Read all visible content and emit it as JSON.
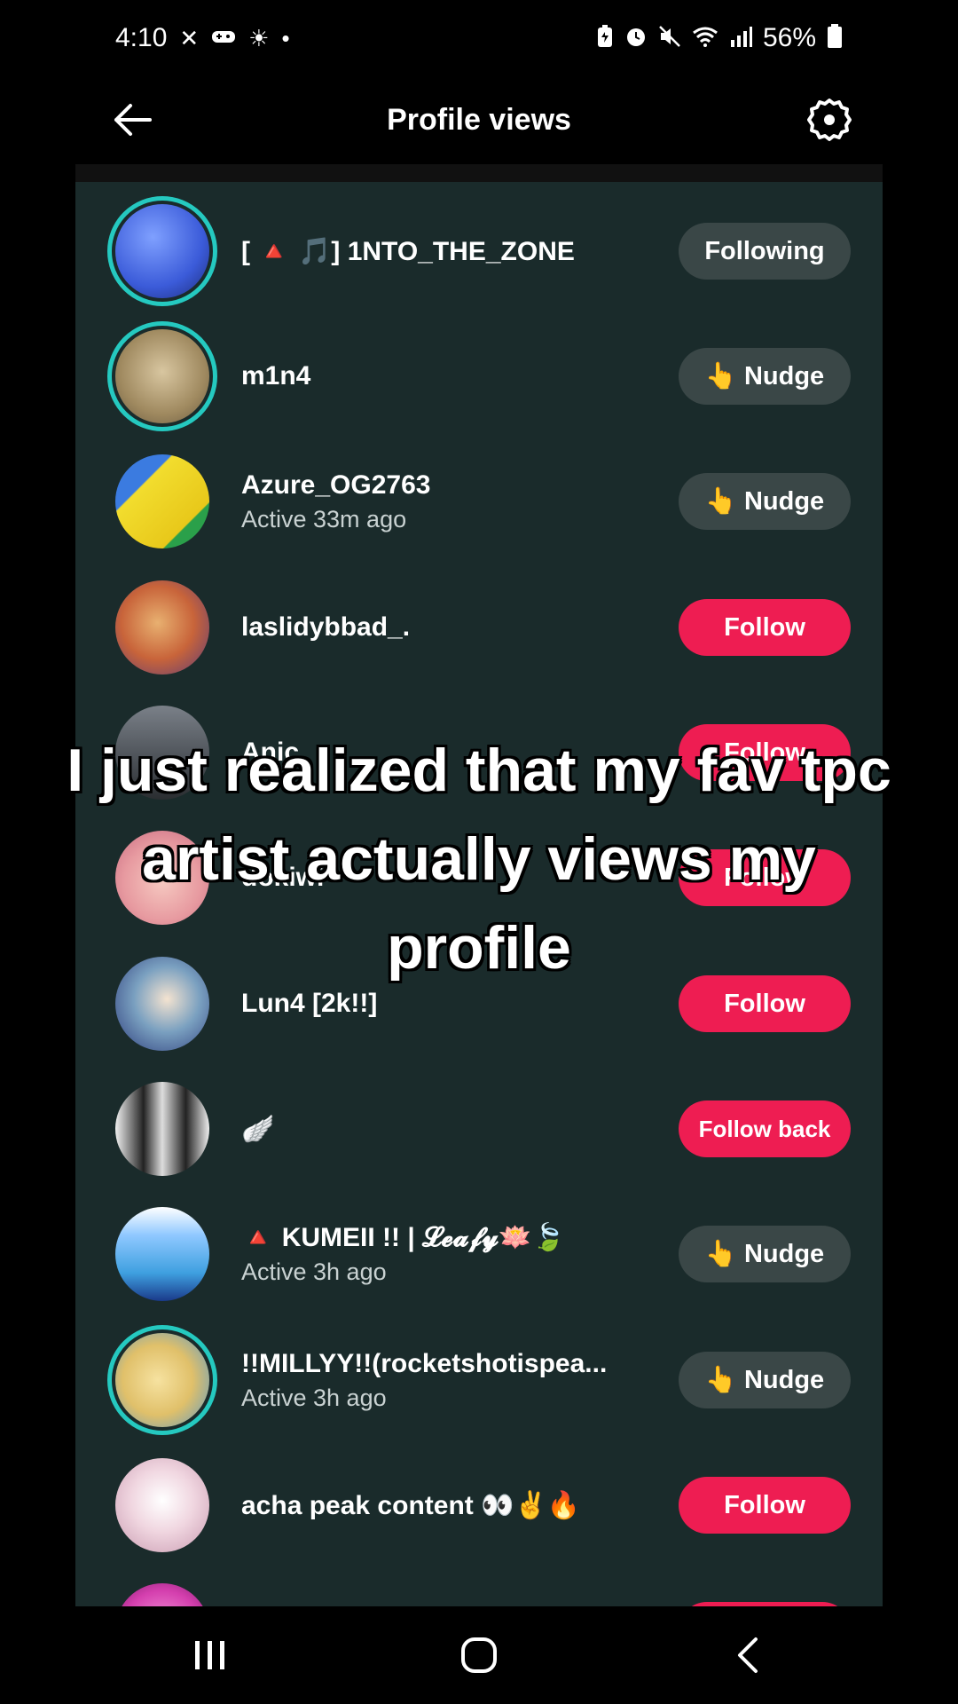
{
  "status_bar": {
    "time": "4:10",
    "battery": "56%"
  },
  "header": {
    "title": "Profile views"
  },
  "rows": [
    {
      "name": "[ 🔺 🎵] 1NTO_THE_ZONE",
      "sub": "",
      "button": "Following",
      "button_style": "gray",
      "ring": true,
      "avatar_color": "#3b5bd9"
    },
    {
      "name": "m1n4",
      "sub": "",
      "button": "👆 Nudge",
      "button_style": "gray",
      "ring": true,
      "avatar_color": "#b7a27a"
    },
    {
      "name": "Azure_OG2763",
      "sub": "Active 33m ago",
      "button": "👆 Nudge",
      "button_style": "gray",
      "ring": false,
      "avatar_color": "#e8d22a"
    },
    {
      "name": "laslidybbad_.",
      "sub": "",
      "button": "Follow",
      "button_style": "red",
      "ring": false,
      "avatar_color": "#c8643a"
    },
    {
      "name": "Anic",
      "sub": "",
      "button": "Follow",
      "button_style": "red",
      "ring": false,
      "avatar_color": "#4a4f55"
    },
    {
      "name": "dokiwi",
      "sub": "",
      "button": "Follow",
      "button_style": "red",
      "ring": false,
      "avatar_color": "#e79aa0"
    },
    {
      "name": "Lun4 [2k!!]",
      "sub": "",
      "button": "Follow",
      "button_style": "red",
      "ring": false,
      "avatar_color": "#2b3a7a"
    },
    {
      "name": "🪽",
      "sub": "",
      "button": "Follow back",
      "button_style": "red",
      "ring": false,
      "avatar_color": "#d9d9d9"
    },
    {
      "name": "🔺 KUMEII !! | 𝓛𝓮𝓪𝓯𝔂🪷🍃",
      "sub": "Active 3h ago",
      "button": "👆 Nudge",
      "button_style": "gray",
      "ring": false,
      "avatar_color": "#3fa0e0"
    },
    {
      "name": "!!MILLYY!!(rocketshotispea...",
      "sub": "Active 3h ago",
      "button": "👆 Nudge",
      "button_style": "gray",
      "ring": true,
      "avatar_color": "#e0c06a"
    },
    {
      "name": "acha peak content 👀✌️🔥",
      "sub": "",
      "button": "Follow",
      "button_style": "red",
      "ring": false,
      "avatar_color": "#f0d6e0"
    },
    {
      "name": "",
      "sub": "",
      "button": "",
      "button_style": "red",
      "ring": false,
      "avatar_color": "#d43fae"
    }
  ],
  "caption": {
    "line1": "I just realized that my fav tpc",
    "line2": "artist actually views my",
    "line3": "profile"
  },
  "colors": {
    "list_bg": "#1a2b2b",
    "follow_red": "#ee1d52",
    "nudge_gray": "#3a4747",
    "ring_teal": "#25c9c0"
  }
}
